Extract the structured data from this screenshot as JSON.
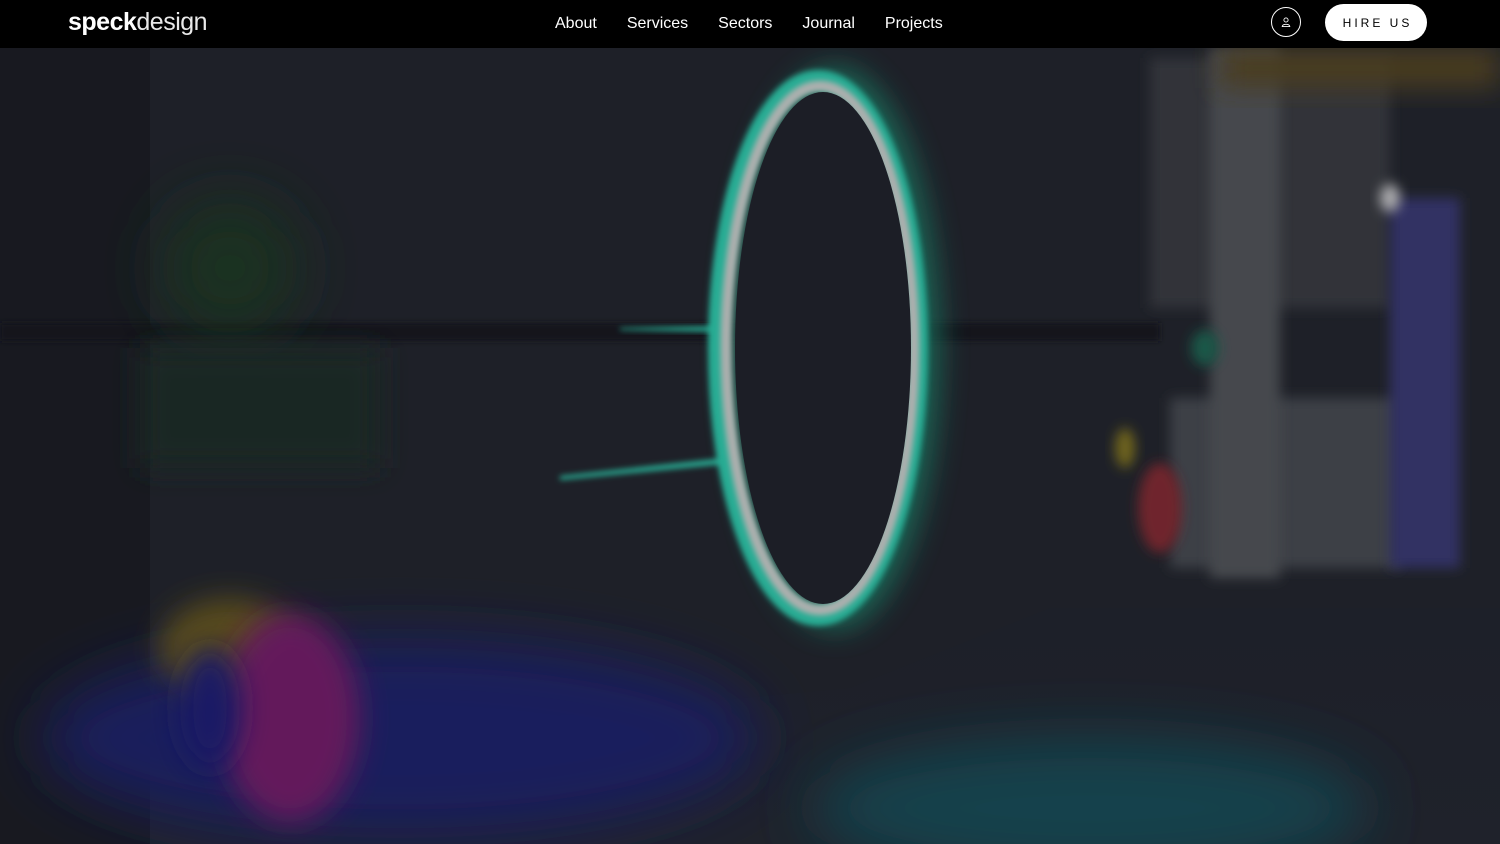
{
  "header": {
    "logo_primary": "speck",
    "logo_secondary": "design",
    "nav": [
      {
        "label": "About"
      },
      {
        "label": "Services"
      },
      {
        "label": "Sectors"
      },
      {
        "label": "Journal"
      },
      {
        "label": "Projects"
      }
    ],
    "account_icon": "user-icon",
    "hire_label": "HIRE US"
  },
  "hero": {
    "media_icon": "product-video-background",
    "accent_color": "#2ed8b6",
    "background_color": "#1b1e26"
  }
}
